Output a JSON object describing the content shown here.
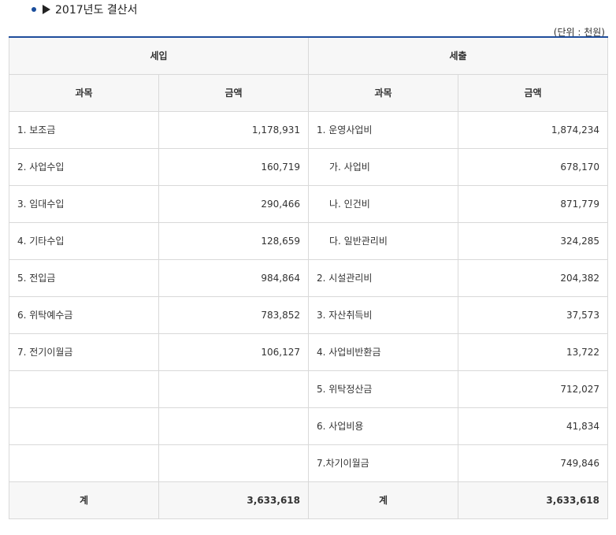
{
  "title": "2017년도 결산서",
  "unit": "(단위 : 천원)",
  "table": {
    "income_header": "세입",
    "expense_header": "세출",
    "col_subject": "과목",
    "col_amount": "금액",
    "rows": [
      {
        "in_item": "1. 보조금",
        "in_amount": "1,178,931",
        "out_item": "1. 운영사업비",
        "out_amount": "1,874,234"
      },
      {
        "in_item": "2. 사업수입",
        "in_amount": "160,719",
        "out_item": "가. 사업비",
        "out_amount": "678,170"
      },
      {
        "in_item": "3. 임대수입",
        "in_amount": "290,466",
        "out_item": "나. 인건비",
        "out_amount": "871,779"
      },
      {
        "in_item": "4. 기타수입",
        "in_amount": "128,659",
        "out_item": "다. 일반관리비",
        "out_amount": "324,285"
      },
      {
        "in_item": "5. 전입금",
        "in_amount": "984,864",
        "out_item": "2. 시설관리비",
        "out_amount": "204,382"
      },
      {
        "in_item": "6. 위탁예수금",
        "in_amount": "783,852",
        "out_item": "3. 자산취득비",
        "out_amount": "37,573"
      },
      {
        "in_item": "7. 전기이월금",
        "in_amount": "106,127",
        "out_item": "4. 사업비반환금",
        "out_amount": "13,722"
      },
      {
        "in_item": "",
        "in_amount": "",
        "out_item": "5. 위탁정산금",
        "out_amount": "712,027"
      },
      {
        "in_item": "",
        "in_amount": "",
        "out_item": "6. 사업비용",
        "out_amount": "41,834"
      },
      {
        "in_item": "",
        "in_amount": "",
        "out_item": "7.차기이월금",
        "out_amount": "749,846"
      }
    ],
    "total": {
      "in_label": "계",
      "in_amount": "3,633,618",
      "out_label": "계",
      "out_amount": "3,633,618"
    }
  }
}
